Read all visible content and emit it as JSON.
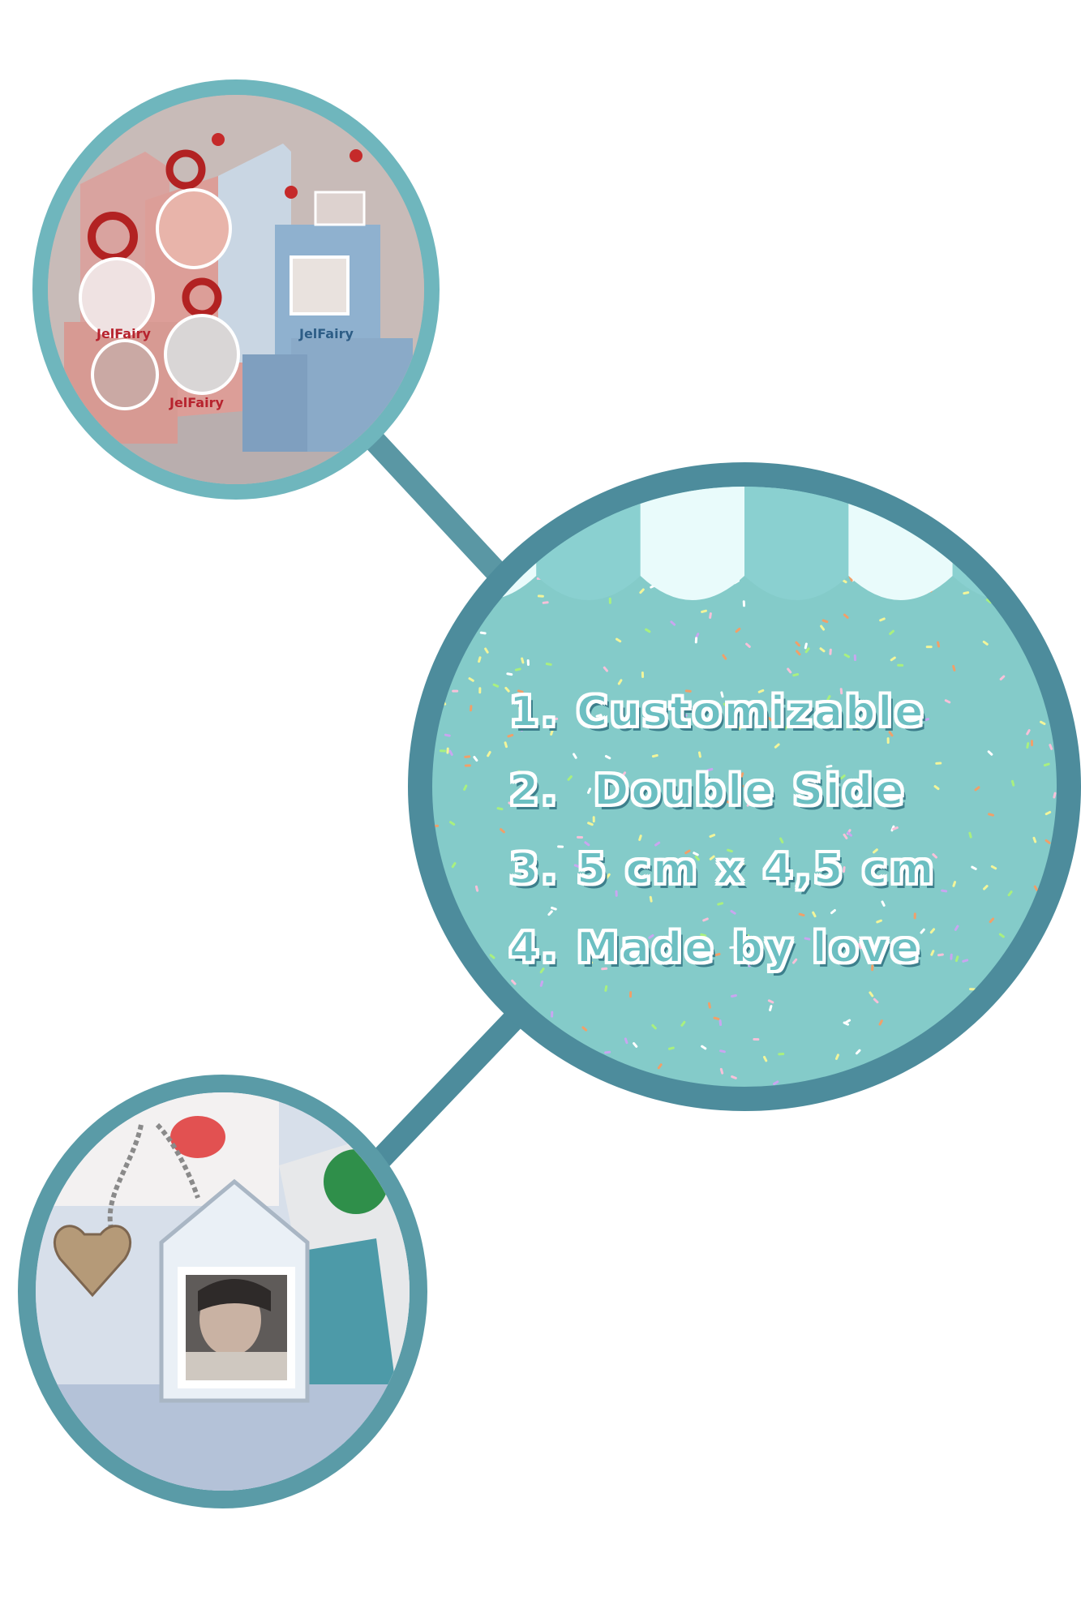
{
  "features": [
    "1. Customizable",
    "2.  Double Side",
    "3. 5 cm x 4,5 cm",
    "4. Made by love"
  ],
  "photos": {
    "top": {
      "label": "JelFairy",
      "subject": "keychains-on-cards"
    },
    "bottom": {
      "subject": "house-shaped-acrylic-keychain"
    }
  },
  "colors": {
    "ring_top": "#6fb6bd",
    "ring_bottom": "#5a9ba7",
    "ring_main": "#4d8c9c",
    "circle_fill": "#84cbc9",
    "awning_light": "#e9fbfb",
    "awning_dark": "#8ad0d0",
    "text_fill": "#6cbfc2",
    "text_shadow": "#3d7f8c"
  }
}
